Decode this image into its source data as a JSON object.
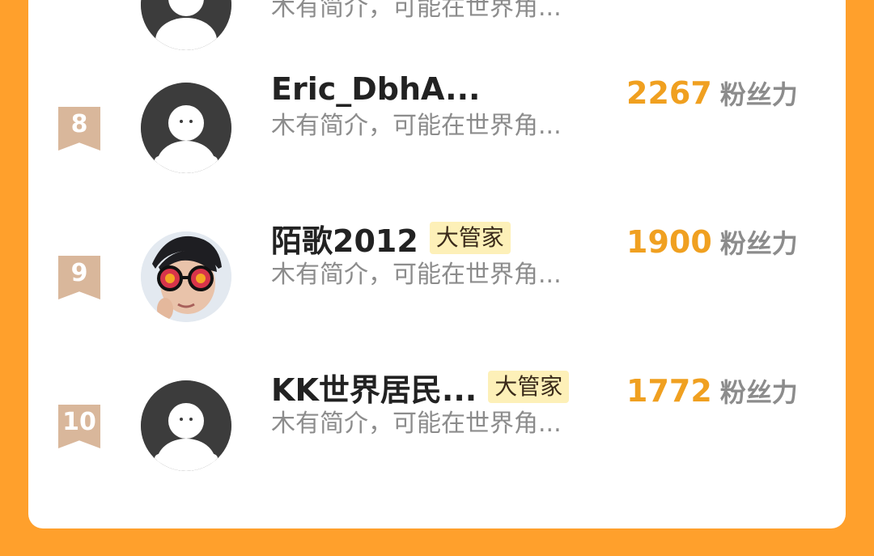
{
  "colors": {
    "background": "#ffa02c",
    "card": "#ffffff",
    "rank_badge": "#d9b79b",
    "fans_number": "#f0a020",
    "text_gray": "#8c8c8c",
    "role_badge_bg": "#fdf0b8"
  },
  "partial_top_row": {
    "bio": "木有简介，可能在世界角...",
    "avatar_icon": "default-avatar-icon"
  },
  "rows": [
    {
      "rank": "8",
      "name": "Eric_DbhA...",
      "badge": "",
      "bio": "木有简介，可能在世界角...",
      "fans_count": "2267",
      "fans_label": "粉丝力",
      "avatar_icon": "default-avatar-icon"
    },
    {
      "rank": "9",
      "name": "陌歌2012",
      "badge": "大管家",
      "bio": "木有简介，可能在世界角...",
      "fans_count": "1900",
      "fans_label": "粉丝力",
      "avatar_icon": "user-photo-avatar"
    },
    {
      "rank": "10",
      "name": "KK世界居民...",
      "badge": "大管家",
      "bio": "木有简介，可能在世界角...",
      "fans_count": "1772",
      "fans_label": "粉丝力",
      "avatar_icon": "default-avatar-icon"
    }
  ]
}
